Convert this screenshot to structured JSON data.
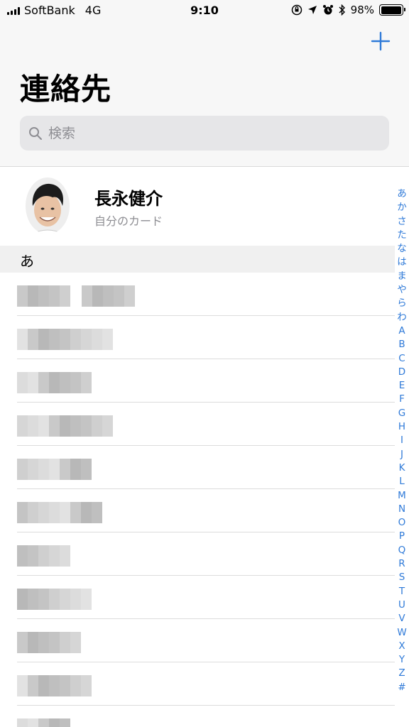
{
  "status": {
    "carrier": "SoftBank",
    "network": "4G",
    "time": "9:10",
    "battery_percent": "98%",
    "battery_level": 0.98,
    "icons": [
      "orientation-lock-icon",
      "location-icon",
      "alarm-icon",
      "bluetooth-icon",
      "battery-icon"
    ]
  },
  "header": {
    "title": "連絡先",
    "add_icon": "plus-icon",
    "search_placeholder": "検索",
    "search_icon": "magnifier-icon"
  },
  "my_card": {
    "name": "長永健介",
    "subtitle": "自分のカード"
  },
  "section": {
    "letter": "あ"
  },
  "index": [
    "あ",
    "か",
    "さ",
    "た",
    "な",
    "は",
    "ま",
    "や",
    "ら",
    "わ",
    "A",
    "B",
    "C",
    "D",
    "E",
    "F",
    "G",
    "H",
    "I",
    "J",
    "K",
    "L",
    "M",
    "N",
    "O",
    "P",
    "Q",
    "R",
    "S",
    "T",
    "U",
    "V",
    "W",
    "X",
    "Y",
    "Z",
    "#"
  ],
  "colors": {
    "accent": "#2f7ad8",
    "header_bg": "#f7f7f7",
    "search_bg": "#e6e6e8",
    "section_bg": "#f0f0f0",
    "secondary_text": "#8e8e93"
  }
}
